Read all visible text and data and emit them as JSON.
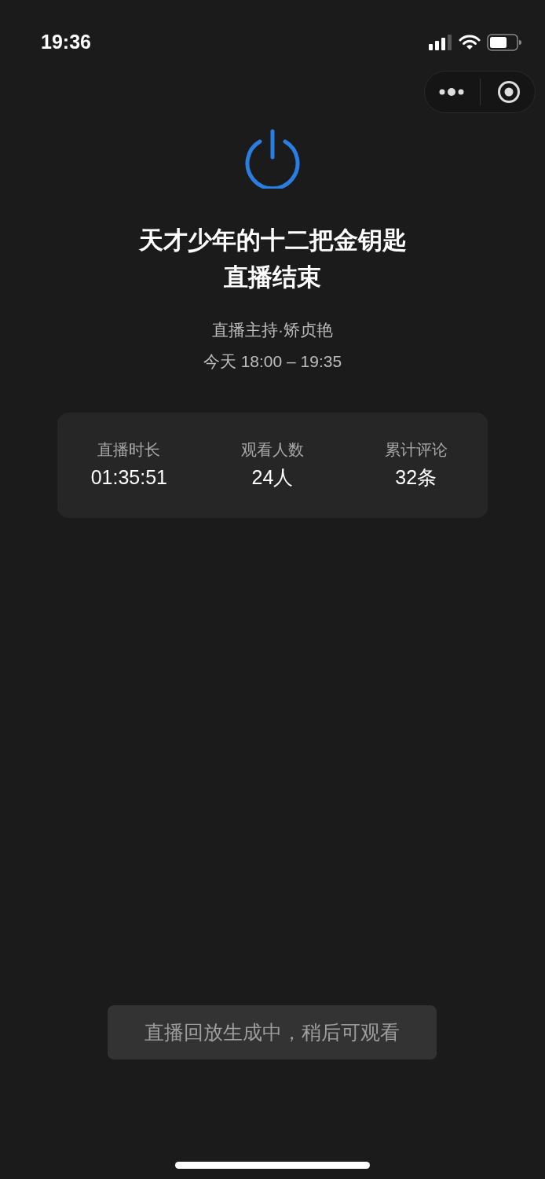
{
  "status_bar": {
    "time": "19:36"
  },
  "title_lines": [
    "天才少年的十二把金钥匙",
    "直播结束"
  ],
  "host": "直播主持·矫贞艳",
  "time_range": "今天 18:00 – 19:35",
  "stats": [
    {
      "label": "直播时长",
      "value": "01:35:51"
    },
    {
      "label": "观看人数",
      "value": "24人"
    },
    {
      "label": "累计评论",
      "value": "32条"
    }
  ],
  "toast": "直播回放生成中，稍后可观看"
}
